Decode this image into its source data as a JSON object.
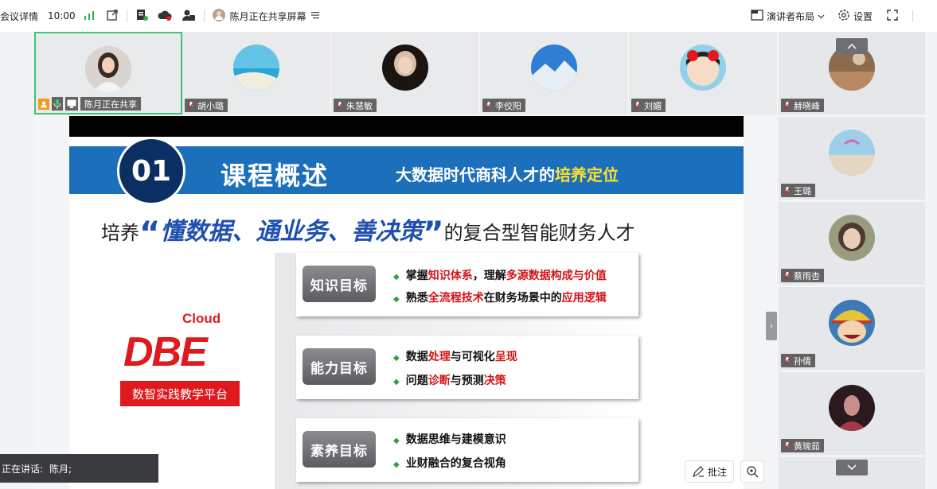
{
  "topbar": {
    "meeting_info": "会议详情",
    "time": "10:00",
    "sharing_user": "陈月正在共享屏幕",
    "layout_label": "演讲者布局",
    "settings_label": "设置"
  },
  "strip": [
    {
      "name": "陈月正在共享",
      "active": true
    },
    {
      "name": "胡小璐"
    },
    {
      "name": "朱慧敏"
    },
    {
      "name": "李佼阳"
    },
    {
      "name": "刘媚"
    }
  ],
  "right_column": [
    {
      "name": "赫晓峰"
    },
    {
      "name": "王璐"
    },
    {
      "name": "蔡雨杏"
    },
    {
      "name": "孙倩"
    },
    {
      "name": "黄琬茹"
    }
  ],
  "slide": {
    "badge": "01",
    "title": "课程概述",
    "subtitle_prefix": "大数据时代商科人才的",
    "subtitle_highlight": "培养定位",
    "headline_prefix": "培养",
    "headline_quote_open": "“",
    "headline_brush": "懂数据、通业务、善决策",
    "headline_quote_close": "”",
    "headline_suffix": "的复合型智能财务人才",
    "logo_cloud": "Cloud",
    "logo_text": "DBE",
    "logo_plate": "数智实践教学平台",
    "goals": [
      {
        "label": "知识目标",
        "line1": {
          "a": "掌握",
          "b": "知识体系",
          "c": "，理解",
          "d": "多源数据构成与价值"
        },
        "line2": {
          "a": "熟悉",
          "b": "全流程技术",
          "c": "在财务场景中的",
          "d": "应用逻辑"
        }
      },
      {
        "label": "能力目标",
        "line1": {
          "a": "数据",
          "b": "处理",
          "c": "与可视化",
          "d": "呈现"
        },
        "line2": {
          "a": "问题",
          "b": "诊断",
          "c": "与预测",
          "d": "决策"
        }
      },
      {
        "label": "素养目标",
        "line1": {
          "a": "数据思维与建模意识"
        },
        "line2": {
          "a": "业财融合的复合视角"
        }
      }
    ]
  },
  "annotation": {
    "label": "批注"
  },
  "speaking": {
    "label": "正在讲话:",
    "name": "陈月;"
  },
  "colors": {
    "accent_green": "#3cc47a",
    "banner_blue": "#1c6fba",
    "red": "#d41418"
  }
}
